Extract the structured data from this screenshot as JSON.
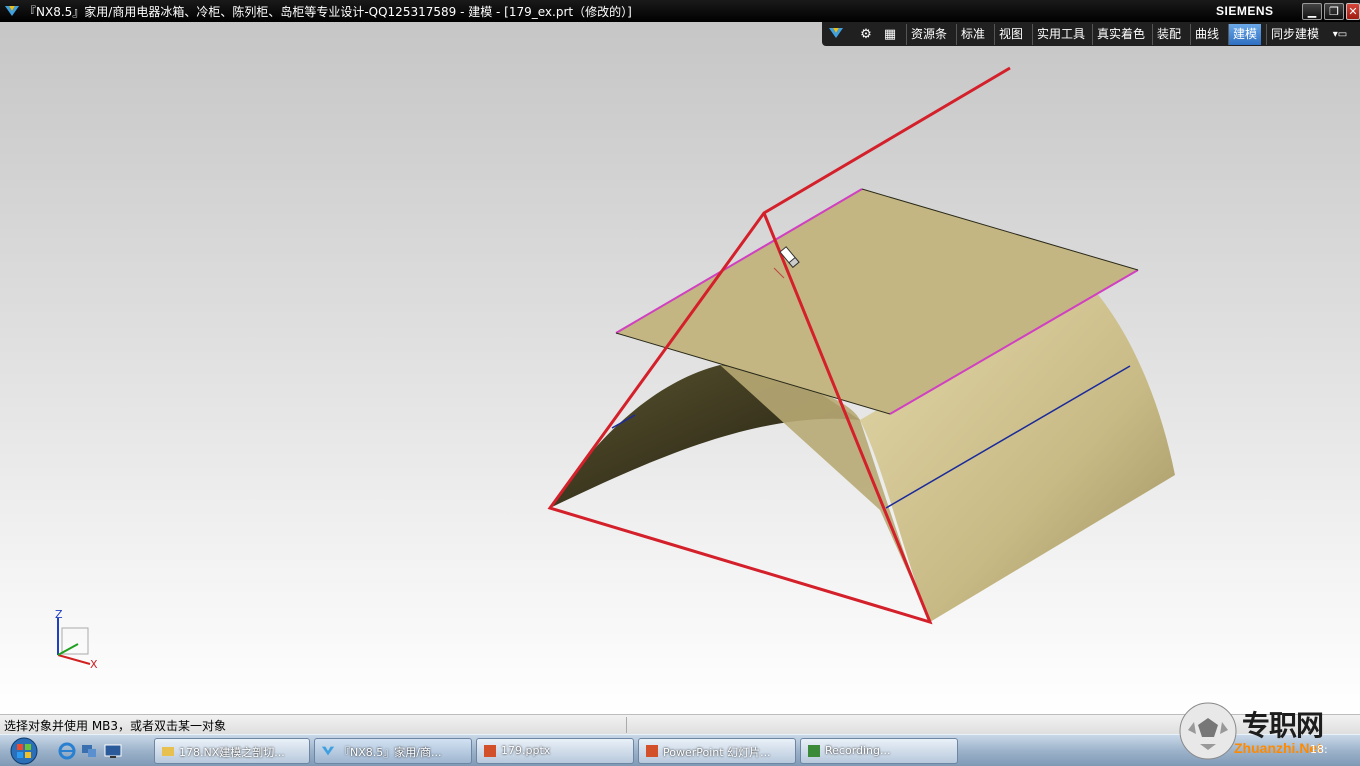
{
  "window": {
    "title": "『NX8.5』家用/商用电器冰箱、冷柜、陈列柜、岛柜等专业设计-QQ125317589 - 建模 - [179_ex.prt（修改的）]",
    "brand": "SIEMENS",
    "buttons": {
      "minimize": "▁",
      "restore": "❐",
      "close": "✕"
    }
  },
  "ribbon": {
    "tabs": [
      {
        "label": "资源条"
      },
      {
        "label": "标准"
      },
      {
        "label": "视图"
      },
      {
        "label": "实用工具"
      },
      {
        "label": "真实着色"
      },
      {
        "label": "装配"
      },
      {
        "label": "曲线"
      },
      {
        "label": "建模",
        "active": true
      },
      {
        "label": "同步建模"
      }
    ]
  },
  "viewport": {
    "axes": {
      "z": "Z",
      "x": "X"
    }
  },
  "status": {
    "prompt": "选择对象并使用 MB3，或者双击某一对象"
  },
  "taskbar": {
    "items": [
      {
        "label": "178.NX建模之剖切..."
      },
      {
        "label": "『NX8.5』家用/商..."
      },
      {
        "label": "179.pptx"
      },
      {
        "label": "PowerPoint 幻灯片..."
      },
      {
        "label": "Recording..."
      }
    ],
    "clock": "18:"
  },
  "watermark": {
    "cn": "专职网",
    "en": "Zhuanzhi.Net"
  },
  "colors": {
    "surface": "#c7bb86",
    "edge_red": "#d4202a",
    "edge_magenta": "#d040c0",
    "edge_blue": "#1a2a9a"
  }
}
